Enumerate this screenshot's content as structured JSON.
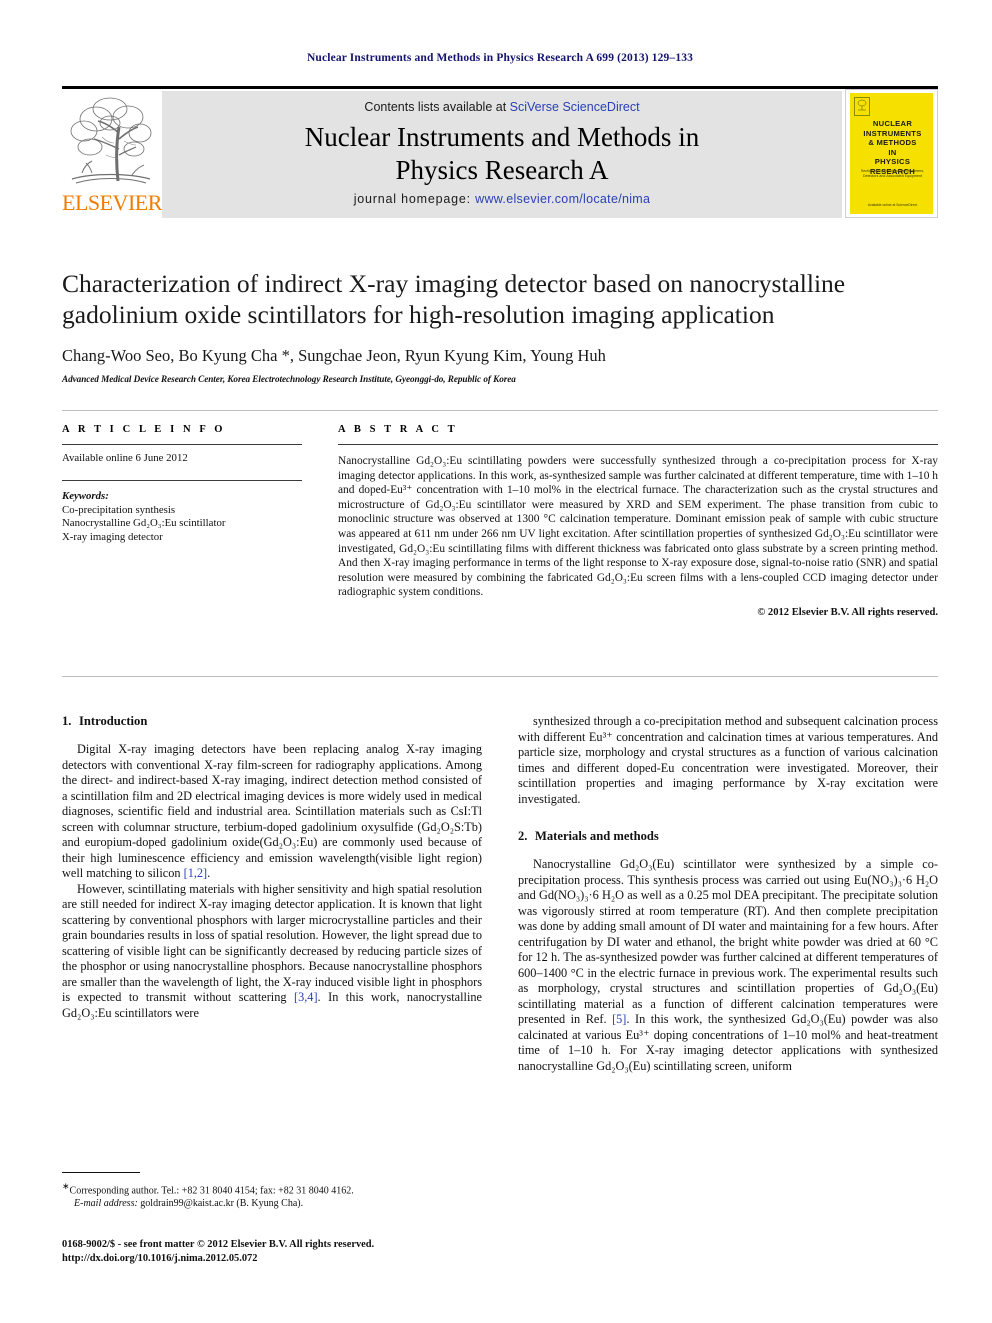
{
  "running_head": "Nuclear Instruments and Methods in Physics Research A 699 (2013) 129–133",
  "masthead": {
    "contents_prefix": "Contents lists available at ",
    "contents_link": "SciVerse ScienceDirect",
    "journal_title_line1": "Nuclear Instruments and Methods in",
    "journal_title_line2": "Physics Research A",
    "homepage_prefix": "journal homepage: ",
    "homepage_url": "www.elsevier.com/locate/nima",
    "publisher_logo_text": "ELSEVIER",
    "publisher_logo_icon": "elsevier-tree-icon",
    "cover": {
      "title_lines": [
        "NUCLEAR",
        "INSTRUMENTS",
        "& METHODS",
        "IN",
        "PHYSICS",
        "RESEARCH"
      ],
      "subtitle": "Section A: Accelerators, Spectrometers, Detectors and Associated Equipment",
      "footer": "Available online at ScienceDirect",
      "badge": "ELSEVIER",
      "background_color": "#f5e000"
    },
    "band_color": "#e3e3e3",
    "link_color": "#2a3fb5"
  },
  "article": {
    "title": "Characterization of indirect X-ray imaging detector based on nanocrystalline gadolinium oxide scintillators for high-resolution imaging application",
    "authors": "Chang-Woo Seo, Bo Kyung Cha *, Sungchae Jeon, Ryun Kyung Kim, Young Huh",
    "affiliation": "Advanced Medical Device Research Center, Korea Electrotechnology Research Institute, Gyeonggi-do, Republic of Korea"
  },
  "article_info": {
    "heading": "A R T I C L E   I N F O",
    "available_online": "Available online 6 June 2012",
    "keywords_label": "Keywords:",
    "keywords": [
      "Co-precipitation synthesis",
      "Nanocrystalline Gd₂O₃:Eu scintillator",
      "X-ray imaging detector"
    ]
  },
  "abstract": {
    "heading": "A B S T R A C T",
    "text": "Nanocrystalline Gd₂O₃:Eu scintillating powders were successfully synthesized through a co-precipitation process for X-ray imaging detector applications. In this work, as-synthesized sample was further calcinated at different temperature, time with 1–10 h and doped-Eu³⁺ concentration with 1–10 mol% in the electrical furnace. The characterization such as the crystal structures and microstructure of Gd₂O₃:Eu scintillator were measured by XRD and SEM experiment. The phase transition from cubic to monoclinic structure was observed at 1300 °C calcination temperature. Dominant emission peak of sample with cubic structure was appeared at 611 nm under 266 nm UV light excitation. After scintillation properties of synthesized Gd₂O₃:Eu scintillator were investigated, Gd₂O₃:Eu scintillating films with different thickness was fabricated onto glass substrate by a screen printing method. And then X-ray imaging performance in terms of the light response to X-ray exposure dose, signal-to-noise ratio (SNR) and spatial resolution were measured by combining the fabricated Gd₂O₃:Eu screen films with a lens-coupled CCD imaging detector under radiographic system conditions.",
    "copyright": "© 2012 Elsevier B.V. All rights reserved."
  },
  "sections": {
    "intro": {
      "number": "1.",
      "title": "Introduction",
      "paragraph1": "Digital X-ray imaging detectors have been replacing analog X-ray imaging detectors with conventional X-ray film-screen for radiography applications. Among the direct- and indirect-based X-ray imaging, indirect detection method consisted of a scintillation film and 2D electrical imaging devices is more widely used in medical diagnoses, scientific field and industrial area. Scintillation materials such as CsI:Tl screen with columnar structure, terbium-doped gadolinium oxysulfide (Gd₂O₂S:Tb) and europium-doped gadolinium oxide(Gd₂O₃:Eu) are commonly used because of their high luminescence efficiency and emission wavelength(visible light region) well matching to silicon [1,2].",
      "paragraph2": "However, scintillating materials with higher sensitivity and high spatial resolution are still needed for indirect X-ray imaging detector application. It is known that light scattering by conventional phosphors with larger microcrystalline particles and their grain boundaries results in loss of spatial resolution. However, the light spread due to scattering of visible light can be significantly decreased by reducing particle sizes of the phosphor or using nanocrystalline phosphors. Because nanocrystalline phosphors are smaller than the wavelength of light, the X-ray induced visible light in phosphors is expected to transmit without scattering [3,4]. In this work, nanocrystalline Gd₂O₃:Eu scintillators were",
      "paragraph3": "synthesized through a co-precipitation method and subsequent calcination process with different Eu³⁺ concentration and calcination times at various temperatures. And particle size, morphology and crystal structures as a function of various calcination times and different doped-Eu concentration were investigated. Moreover, their scintillation properties and imaging performance by X-ray excitation were investigated."
    },
    "materials": {
      "number": "2.",
      "title": "Materials and methods",
      "paragraph1": "Nanocrystalline Gd₂O₃(Eu) scintillator were synthesized by a simple co-precipitation process. This synthesis process was carried out using Eu(NO₃)₃·6 H₂O and Gd(NO₃)₃·6 H₂O as well as a 0.25 mol DEA precipitant. The precipitate solution was vigorously stirred at room temperature (RT). And then complete precipitation was done by adding small amount of DI water and maintaining for a few hours. After centrifugation by DI water and ethanol, the bright white powder was dried at 60 °C for 12 h. The as-synthesized powder was further calcined at different temperatures of 600–1400 °C in the electric furnace in previous work. The experimental results such as morphology, crystal structures and scintillation properties of Gd₂O₃(Eu) scintillating material as a function of different calcination temperatures were presented in Ref. [5]. In this work, the synthesized Gd₂O₃(Eu) powder was also calcinated at various Eu³⁺ doping concentrations of 1–10 mol% and heat-treatment time of 1–10 h. For X-ray imaging detector applications with synthesized nanocrystalline Gd₂O₃(Eu) scintillating screen, uniform"
    }
  },
  "footnote": {
    "corresponding": "Corresponding author. Tel.: +82 31 8040 4154; fax: +82 31 8040 4162.",
    "email_label": "E-mail address:",
    "email": "goldrain99@kaist.ac.kr (B. Kyung Cha)."
  },
  "imprint": {
    "line1": "0168-9002/$ - see front matter © 2012 Elsevier B.V. All rights reserved.",
    "line2": "http://dx.doi.org/10.1016/j.nima.2012.05.072"
  }
}
